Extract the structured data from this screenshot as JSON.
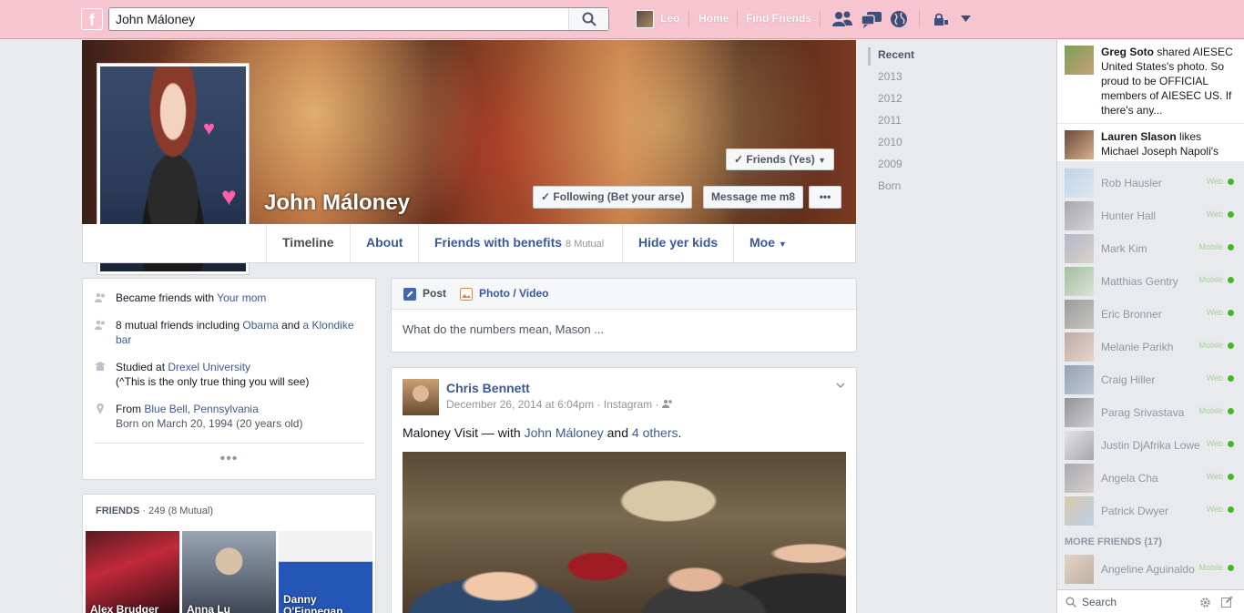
{
  "topbar": {
    "logo": "f",
    "search_value": "John Máloney",
    "user_name": "Leo",
    "home": "Home",
    "find_friends": "Find Friends"
  },
  "cover": {
    "name": "John Máloney",
    "friends_button": "Friends (Yes)",
    "following_button": "Following (Bet your arse)",
    "message_button": "Message me m8",
    "more_button": "•••"
  },
  "tabs": [
    {
      "label": "Timeline"
    },
    {
      "label": "About"
    },
    {
      "label": "Friends with benefits",
      "sub": "8 Mutual"
    },
    {
      "label": "Hide yer kids"
    },
    {
      "label": "Moe"
    }
  ],
  "intro": {
    "row1_text": "Became friends with ",
    "row1_link": "Your mom",
    "row2_text": "8 mutual friends including ",
    "row2_link1": "Obama",
    "row2_and": " and ",
    "row2_link2": "a Klondike bar",
    "row3_text": "Studied at ",
    "row3_link": "Drexel University",
    "row3_note": "(^This is the only true thing you will see)",
    "row4_text": "From ",
    "row4_link": "Blue Bell, Pennsylvania",
    "row4_born": "Born on March 20, 1994 (20 years old)",
    "more": "•••"
  },
  "friends": {
    "title": "FRIENDS",
    "count": " · 249 (8 Mutual)",
    "tiles": [
      {
        "name": "Alex Brudger"
      },
      {
        "name": "Anna Lu"
      },
      {
        "name": "Danny O'Finnegan"
      }
    ]
  },
  "composer": {
    "post_tab": "Post",
    "photo_tab": "Photo / Video",
    "placeholder": "What do the numbers mean, Mason ..."
  },
  "post": {
    "author": "Chris Bennett",
    "meta": "December 26, 2014 at 6:04pm · Instagram ·",
    "text_prefix": "Maloney Visit — with ",
    "text_link1": "John Máloney",
    "text_and": " and ",
    "text_link2": "4 others",
    "text_suffix": "."
  },
  "years": [
    "Recent",
    "2013",
    "2012",
    "2011",
    "2010",
    "2009",
    "Born"
  ],
  "ticker": [
    {
      "name": "Greg Soto",
      "text": " shared AIESEC United States's photo. So proud to be OFFICIAL members of AIESEC US. If there's any..."
    },
    {
      "name": "Lauren Slason",
      "text": " likes Michael Joseph Napoli's"
    }
  ],
  "chat": [
    {
      "name": "Rob Hausler",
      "status": "Web"
    },
    {
      "name": "Hunter Hall",
      "status": "Web"
    },
    {
      "name": "Mark Kim",
      "status": "Mobile"
    },
    {
      "name": "Matthias Gentry",
      "status": "Mobile"
    },
    {
      "name": "Eric Bronner",
      "status": "Web"
    },
    {
      "name": "Melanie Parikh",
      "status": "Mobile"
    },
    {
      "name": "Craig Hiller",
      "status": "Web"
    },
    {
      "name": "Parag Srivastava",
      "status": "Mobile"
    },
    {
      "name": "Justin DjAfrika Lowe",
      "status": "Web"
    },
    {
      "name": "Angela Cha",
      "status": "Web"
    },
    {
      "name": "Patrick Dwyer",
      "status": "Web"
    }
  ],
  "more_friends": "MORE FRIENDS (17)",
  "more_chat": {
    "name": "Angeline Aguinaldo",
    "status": "Mobile"
  },
  "chat_search": "Search"
}
